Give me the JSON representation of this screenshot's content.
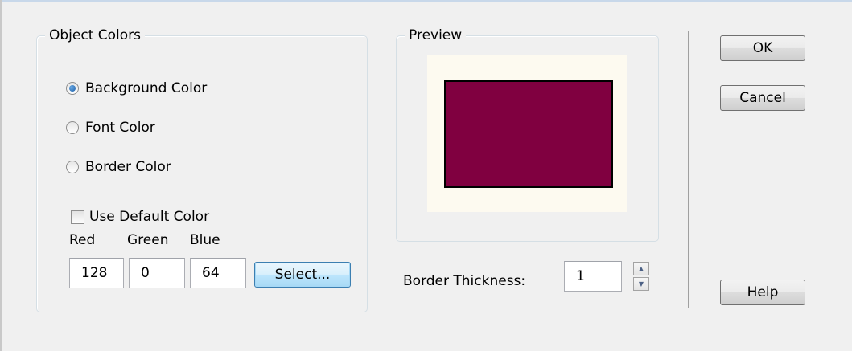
{
  "object_colors": {
    "title": "Object Colors",
    "options": [
      {
        "label": "Background Color",
        "checked": true
      },
      {
        "label": "Font Color",
        "checked": false
      },
      {
        "label": "Border Color",
        "checked": false
      }
    ],
    "use_default": {
      "label": "Use Default Color",
      "checked": false
    },
    "rgb_labels": {
      "red": "Red",
      "green": "Green",
      "blue": "Blue"
    },
    "rgb_values": {
      "red": "128",
      "green": "0",
      "blue": "64"
    },
    "select_label": "Select..."
  },
  "preview": {
    "title": "Preview",
    "canvas_color": "#fdfaf0",
    "fill_color": "#800040",
    "border_color": "#000000"
  },
  "border_thickness": {
    "label": "Border Thickness:",
    "value": "1",
    "up_icon": "spin-up-icon",
    "down_icon": "spin-down-icon"
  },
  "buttons": {
    "ok": "OK",
    "cancel": "Cancel",
    "help": "Help"
  }
}
